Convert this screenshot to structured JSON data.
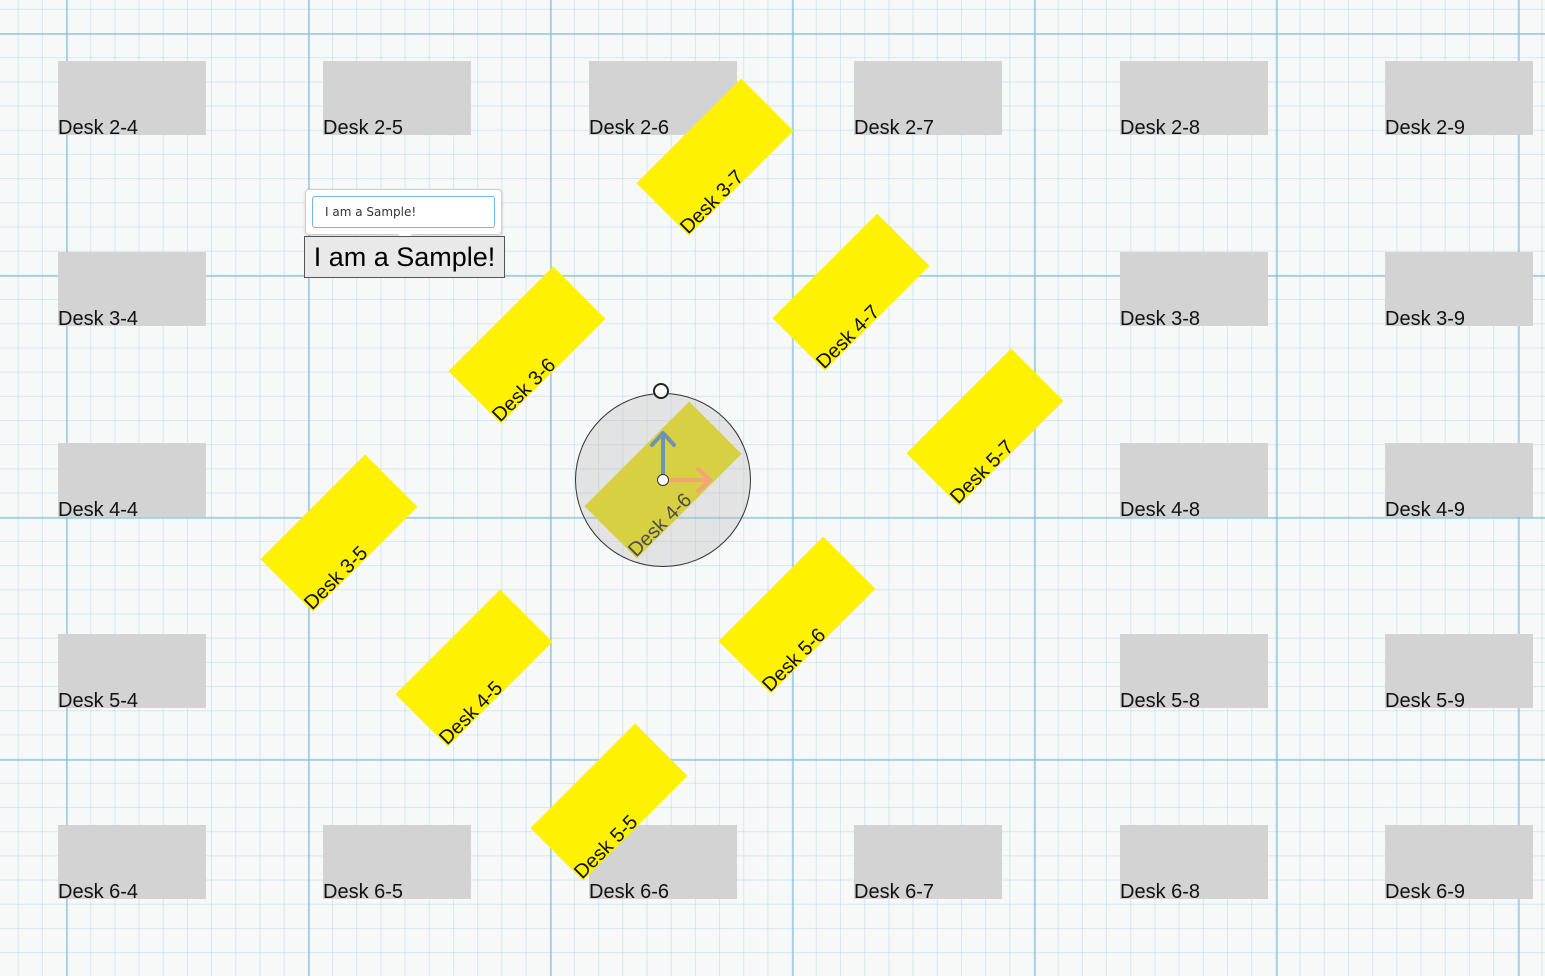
{
  "desks": [
    {
      "label": "Desk 2-4"
    },
    {
      "label": "Desk 2-5"
    },
    {
      "label": "Desk 2-6"
    },
    {
      "label": "Desk 2-7"
    },
    {
      "label": "Desk 2-8"
    },
    {
      "label": "Desk 2-9"
    },
    {
      "label": "Desk 3-4"
    },
    {
      "label": "Desk 3-8"
    },
    {
      "label": "Desk 3-9"
    },
    {
      "label": "Desk 4-4"
    },
    {
      "label": "Desk 4-8"
    },
    {
      "label": "Desk 4-9"
    },
    {
      "label": "Desk 5-4"
    },
    {
      "label": "Desk 5-8"
    },
    {
      "label": "Desk 5-9"
    },
    {
      "label": "Desk 6-4"
    },
    {
      "label": "Desk 6-5"
    },
    {
      "label": "Desk 6-6"
    },
    {
      "label": "Desk 6-7"
    },
    {
      "label": "Desk 6-8"
    },
    {
      "label": "Desk 6-9"
    }
  ],
  "rotated_desks": [
    {
      "label": "Desk 3-7"
    },
    {
      "label": "Desk 4-7"
    },
    {
      "label": "Desk 3-6"
    },
    {
      "label": "Desk 5-7"
    },
    {
      "label": "Desk 4-6"
    },
    {
      "label": "Desk 3-5"
    },
    {
      "label": "Desk 5-6"
    },
    {
      "label": "Desk 4-5"
    },
    {
      "label": "Desk 5-5"
    }
  ],
  "rotation_degrees": -45,
  "selected_desk": "Desk 4-6",
  "text_editor": {
    "value": "I am a Sample!"
  },
  "text_object": {
    "label": "I am a Sample!"
  },
  "colors": {
    "desk": "#d3d3d3",
    "rotated_desk": "#fff200",
    "selected_desk": "#e5da00",
    "x_axis": "#f4a37a",
    "y_axis": "#6f93b3"
  }
}
